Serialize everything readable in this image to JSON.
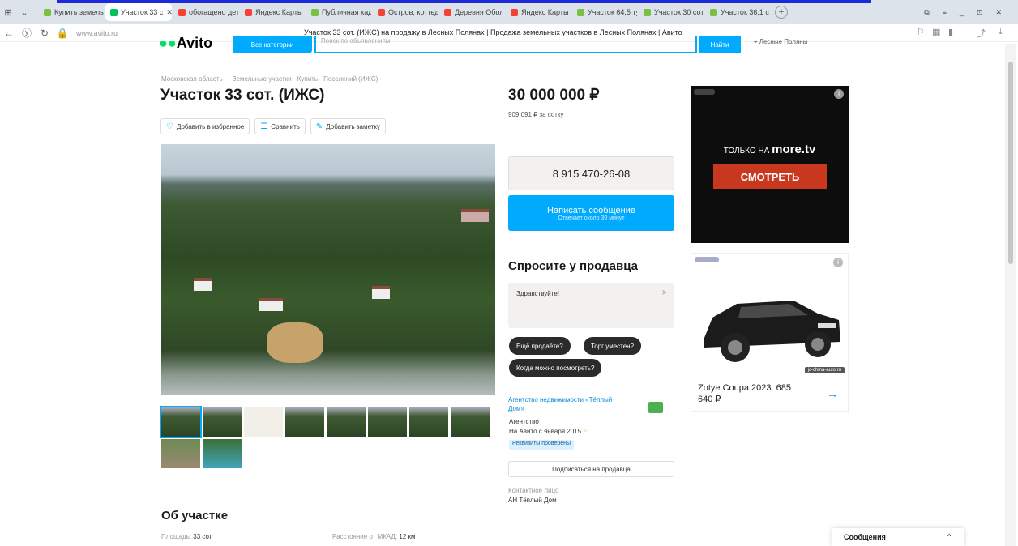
{
  "tabs": [
    {
      "label": "Купить земельн",
      "color": "#7bc043"
    },
    {
      "label": "Участок 33 с",
      "color": "#04c15f",
      "active": true
    },
    {
      "label": "обогащено дет",
      "color": "#f44336"
    },
    {
      "label": "Яндекс Карты",
      "color": "#f44336"
    },
    {
      "label": "Публичная кад",
      "color": "#7bc043"
    },
    {
      "label": "Остров, коттедж",
      "color": "#f44336"
    },
    {
      "label": "Деревня Обол",
      "color": "#f44336"
    },
    {
      "label": "Яндекс Карты",
      "color": "#f44336"
    },
    {
      "label": "Участок 64,5 ту",
      "color": "#7bc043"
    },
    {
      "label": "Участок 30 сот",
      "color": "#7bc043"
    },
    {
      "label": "Участок 36,1 с",
      "color": "#7bc043"
    }
  ],
  "browser": {
    "url": "www.avito.ru",
    "page_title": "Участок 33 сот. (ИЖС) на продажу в Лесных Полянах | Продажа земельных участков в Лесных Полянах | Авито"
  },
  "header": {
    "logo": "Avito",
    "categories_label": "Все категории",
    "search_placeholder": "Поиск по объявлениям",
    "find_label": "Найти",
    "location": "Лесные Поляны"
  },
  "listing": {
    "breadcrumb": "Московская область · · Земельные участки · Купить · Поселений (ИЖС)",
    "title": "Участок 33 сот. (ИЖС)",
    "actions": [
      "Добавить в избранное",
      "Сравнить",
      "Добавить заметку"
    ],
    "price": "30 000 000 ₽",
    "price_per_unit": "909 091 ₽ за сотку",
    "phone": "8 915 470-26-08",
    "message_label": "Написать сообщение",
    "message_sub": "Отвечает около 30 минут"
  },
  "ask": {
    "title": "Спросите у продавца",
    "placeholder": "Здравствуйте!",
    "chips": [
      "Ещё продаёте?",
      "Торг уместен?",
      "Когда можно посмотреть?"
    ]
  },
  "seller": {
    "name": "Агентство недвижимости «Тёплый Дом»",
    "type": "Агентство",
    "since": "На Авито с января 2015",
    "verified": "Реквизиты проверены",
    "subscribe": "Подписаться на продавца",
    "contact_label": "Контактное лицо",
    "contact_name": "АН Тёплый Дом"
  },
  "ads": {
    "ad1_text": "ТОЛЬКО НА",
    "ad1_brand": "more.tv",
    "ad1_cta": "СМОТРЕТЬ",
    "ad2_site": "jc-china-auto.ru",
    "ad2_name": "Zotye Coupa 2023. 685 640 ₽"
  },
  "about": {
    "title": "Об участке",
    "area_label": "Площадь:",
    "area_value": "33 сот.",
    "distance_label": "Расстояние от МКАД:",
    "distance_value": "12 км"
  },
  "messages": {
    "label": "Сообщения"
  }
}
